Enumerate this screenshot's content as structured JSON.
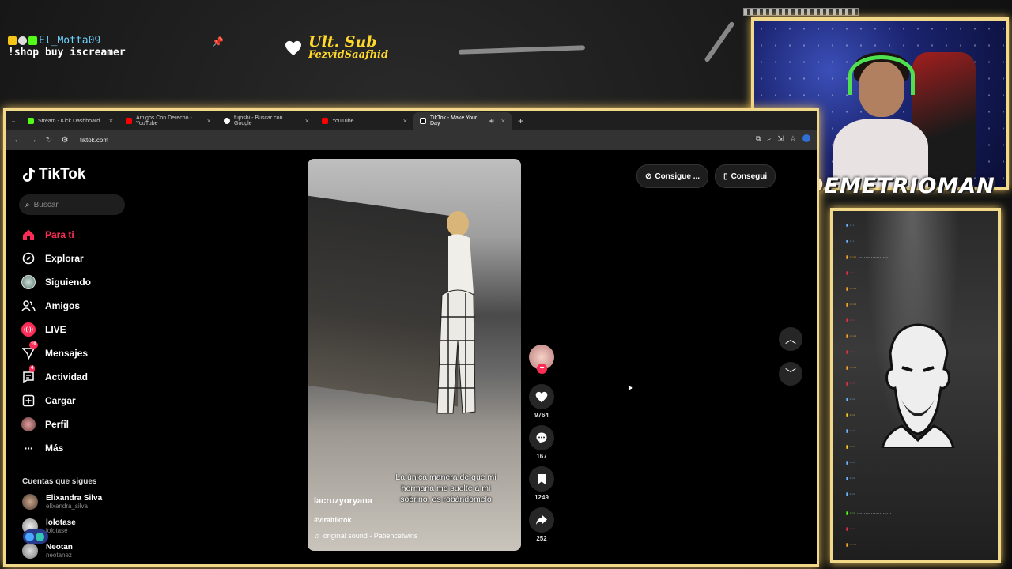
{
  "overlay": {
    "chat_user": "El_Motta09",
    "chat_message": "!shop buy iscreamer",
    "last_sub_title": "Ult. Sub",
    "last_sub_name": "FezvidSaafhid",
    "streamer_name": "DEMETRIOMAN"
  },
  "browser": {
    "tabs": [
      {
        "label": "Stream - Kick Dashboard",
        "color": "#53fc18"
      },
      {
        "label": "Amigos Con Derecho - YouTube",
        "color": "#ff0000"
      },
      {
        "label": "fujoshi - Buscar con Google",
        "color": "#ffffff"
      },
      {
        "label": "YouTube",
        "color": "#ff0000"
      },
      {
        "label": "TikTok - Make Your Day",
        "color": "#ffffff"
      }
    ],
    "url": "tiktok.com"
  },
  "tiktok": {
    "logo": "TikTok",
    "search_placeholder": "Buscar",
    "nav": [
      {
        "label": "Para ti",
        "icon": "home-icon"
      },
      {
        "label": "Explorar",
        "icon": "compass-icon"
      },
      {
        "label": "Siguiendo",
        "icon": "following-icon"
      },
      {
        "label": "Amigos",
        "icon": "friends-icon"
      },
      {
        "label": "LIVE",
        "icon": "live-icon"
      },
      {
        "label": "Mensajes",
        "icon": "messages-icon",
        "badge": "19"
      },
      {
        "label": "Actividad",
        "icon": "activity-icon",
        "badge": "4"
      },
      {
        "label": "Cargar",
        "icon": "upload-icon"
      },
      {
        "label": "Perfil",
        "icon": "profile-icon"
      },
      {
        "label": "Más",
        "icon": "more-icon"
      }
    ],
    "following_title": "Cuentas que sigues",
    "following": [
      {
        "name": "Elixandra Silva",
        "handle": "elixandra_silva"
      },
      {
        "name": "lolotase",
        "handle": "lolotase"
      },
      {
        "name": "Neotan",
        "handle": "neotanez"
      }
    ],
    "top_buttons": [
      "Consigue ...",
      "Consegui"
    ],
    "video": {
      "username": "lacruzyoryana",
      "caption": "La única manera de que mi hermana me suelte a mi sobrino, es robándomelo",
      "hashtag": "#viraltiktok",
      "sound": "original sound - Patiencetwins"
    },
    "actions": {
      "likes": "9764",
      "comments": "167",
      "saves": "1249",
      "shares": "252"
    }
  },
  "colors": {
    "accent": "#fe2c55",
    "frame": "#f2d98a"
  }
}
